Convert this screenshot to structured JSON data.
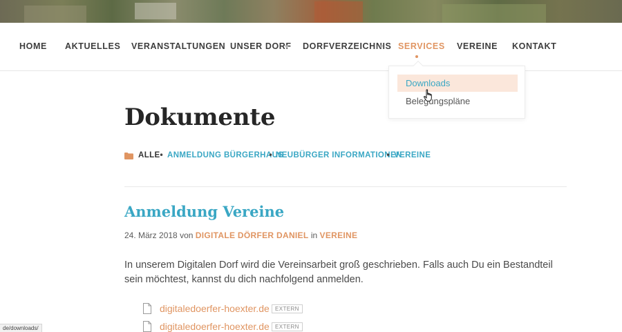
{
  "nav": {
    "items": [
      {
        "label": "HOME"
      },
      {
        "label": "AKTUELLES"
      },
      {
        "label": "VERANSTALTUNGEN"
      },
      {
        "label": "UNSER DORF"
      },
      {
        "label": "DORFVERZEICHNIS"
      },
      {
        "label": "SERVICES"
      },
      {
        "label": "VEREINE"
      },
      {
        "label": "KONTAKT"
      }
    ],
    "active": "SERVICES",
    "dropdown": [
      "Downloads",
      "Belegungspläne"
    ]
  },
  "page": {
    "title": "Dokumente",
    "filters": [
      "ALLE",
      "ANMELDUNG BÜRGERHAUS",
      "NEUBÜRGER INFORMATIONEN",
      "VEREINE"
    ],
    "filter_separator": "•"
  },
  "post": {
    "title": "Anmeldung Vereine",
    "date": "24. März 2018",
    "by": "von",
    "author": "DIGITALE DÖRFER DANIEL",
    "in": "in",
    "category": "VEREINE",
    "excerpt": "In unserem Digitalen Dorf wird die Vereinsarbeit groß geschrieben. Falls auch Du ein Bestandteil sein möchtest, kannst du dich nachfolgend anmelden.",
    "files": [
      {
        "name": "digitaledoerfer-hoexter.de",
        "badge": "EXTERN"
      },
      {
        "name": "digitaledoerfer-hoexter.de",
        "badge": "EXTERN"
      }
    ]
  },
  "status_bar": {
    "url": "de/downloads/"
  },
  "colors": {
    "accent_orange": "#e09562",
    "link_blue": "#3aa7c4",
    "hover_bg": "#fbe7db"
  }
}
